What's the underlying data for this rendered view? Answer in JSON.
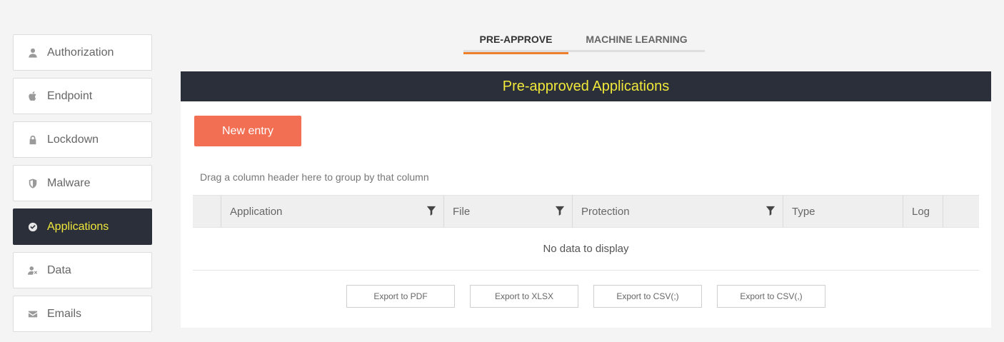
{
  "sidebar": {
    "items": [
      {
        "label": "Authorization",
        "icon": "user-icon"
      },
      {
        "label": "Endpoint",
        "icon": "apple-icon"
      },
      {
        "label": "Lockdown",
        "icon": "lock-icon"
      },
      {
        "label": "Malware",
        "icon": "shield-icon"
      },
      {
        "label": "Applications",
        "icon": "check-circle-icon",
        "active": true
      },
      {
        "label": "Data",
        "icon": "user-x-icon"
      },
      {
        "label": "Emails",
        "icon": "envelope-icon"
      }
    ]
  },
  "tabs": [
    {
      "label": "PRE-APPROVE",
      "active": true
    },
    {
      "label": "MACHINE LEARNING",
      "active": false
    }
  ],
  "panel": {
    "title": "Pre-approved Applications",
    "new_entry_label": "New entry",
    "group_hint": "Drag a column header here to group by that column"
  },
  "grid": {
    "columns": [
      {
        "label": "Application",
        "filter": true
      },
      {
        "label": "File",
        "filter": true
      },
      {
        "label": "Protection",
        "filter": true
      },
      {
        "label": "Type",
        "filter": false
      },
      {
        "label": "Log",
        "filter": false
      }
    ],
    "empty_text": "No data to display"
  },
  "exports": [
    "Export to PDF",
    "Export to XLSX",
    "Export to CSV(;)",
    "Export to CSV(,)"
  ],
  "colors": {
    "accent_orange": "#ee7f2d",
    "button_red": "#f26f53",
    "dark_header": "#2b2f3a",
    "highlight_yellow": "#f0e83a"
  }
}
